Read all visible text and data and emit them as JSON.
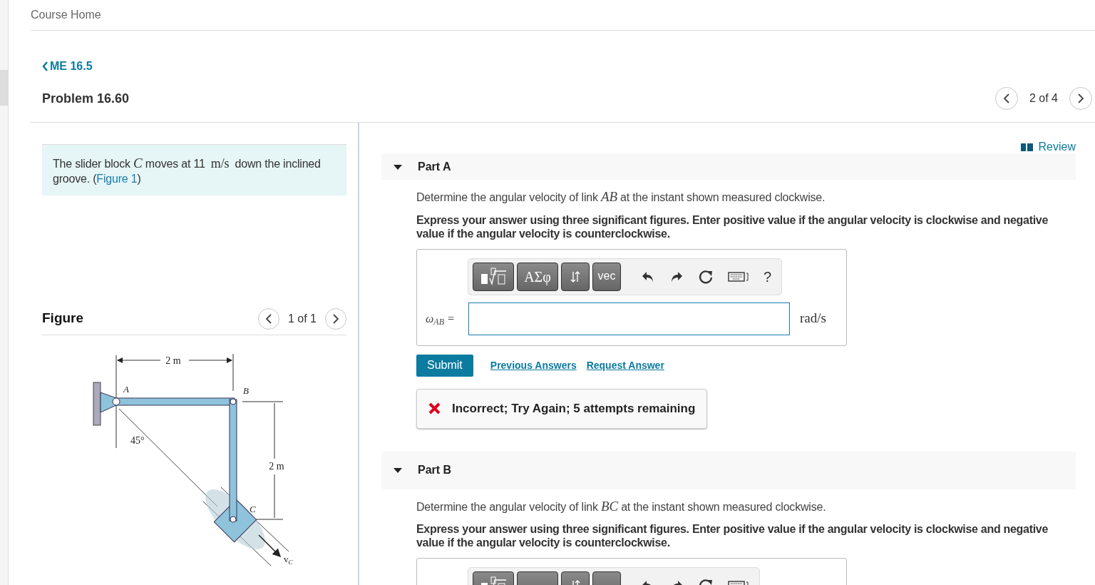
{
  "header": {
    "course_home": "Course Home"
  },
  "breadcrumb": {
    "back": "ME 16.5"
  },
  "problem": {
    "title": "Problem 16.60",
    "pager": "2 of 4"
  },
  "statement": {
    "segments": [
      {
        "kind": "text",
        "text": "The slider block "
      },
      {
        "kind": "math",
        "text": "C"
      },
      {
        "kind": "text",
        "text": " moves at 11 "
      },
      {
        "kind": "unit",
        "text": "m/s"
      },
      {
        "kind": "text",
        "text": " down the inclined groove. ("
      },
      {
        "kind": "link",
        "text": "Figure 1"
      },
      {
        "kind": "text",
        "text": ")"
      }
    ]
  },
  "figure": {
    "title": "Figure",
    "pager": "1 of 1",
    "labels": [
      {
        "text": "2 m"
      },
      {
        "text": "A"
      },
      {
        "text": "B"
      },
      {
        "text": "45°"
      },
      {
        "text": "2 m"
      },
      {
        "text": "C"
      },
      {
        "text": "v",
        "sub": "C"
      }
    ]
  },
  "review": "Review",
  "parts": [
    {
      "title": "Part A",
      "expanded": true,
      "question": [
        {
          "kind": "text",
          "text": "Determine the angular velocity of link "
        },
        {
          "kind": "math",
          "text": "AB"
        },
        {
          "kind": "text",
          "text": " at the instant shown measured clockwise."
        }
      ],
      "instruction": "Express your answer using three significant figures. Enter positive value if the angular velocity is clockwise and negative value if the angular velocity is counterclockwise.",
      "toolbar": [
        "ΑΣφ",
        "vec",
        "?"
      ],
      "answer": {
        "label": "ω$_{AB}$ =",
        "units": "rad/s"
      },
      "actions": {
        "submit": "Submit",
        "links": [
          "Previous Answers",
          "Request Answer"
        ]
      },
      "feedback": {
        "kind": "incorrect",
        "text": "Incorrect; Try Again; 5 attempts remaining"
      }
    },
    {
      "title": "Part B",
      "expanded": true,
      "question": [
        {
          "kind": "text",
          "text": "Determine the angular velocity of link "
        },
        {
          "kind": "math",
          "text": "BC"
        },
        {
          "kind": "text",
          "text": " at the instant shown measured clockwise."
        }
      ],
      "instruction": "Express your answer using three significant figures. Enter positive value if the angular velocity is clockwise and negative value if the angular velocity is counterclockwise."
    }
  ]
}
